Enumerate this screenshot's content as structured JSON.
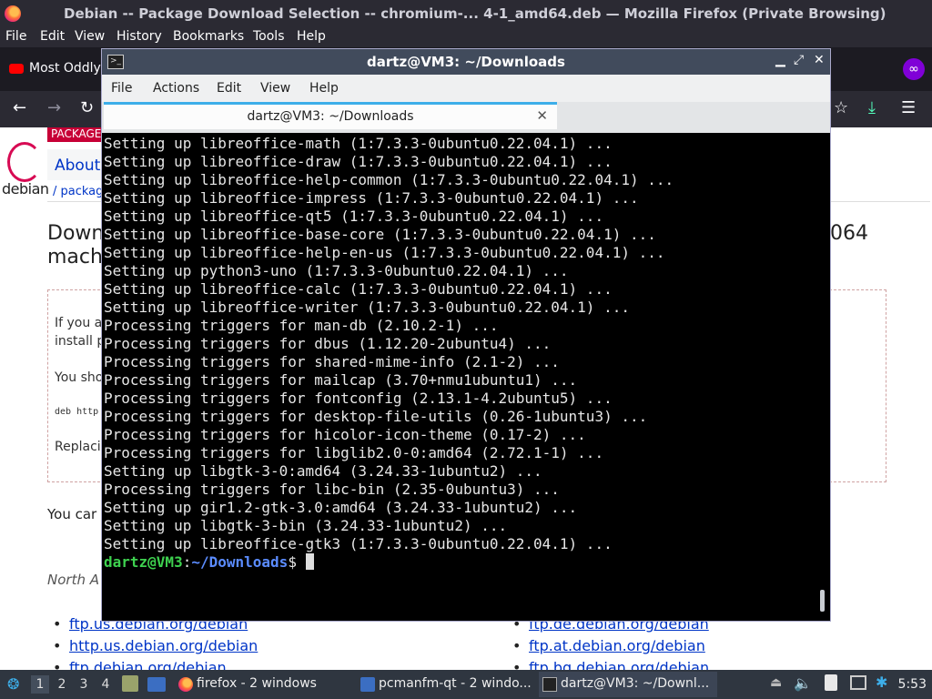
{
  "firefox": {
    "window_title": "Debian -- Package Download Selection -- chromium-... 4-1_amd64.deb — Mozilla Firefox (Private Browsing)",
    "menu": [
      "File",
      "Edit",
      "View",
      "History",
      "Bookmarks",
      "Tools",
      "Help"
    ],
    "tab_label": "Most Oddly",
    "icons": [
      "back-icon",
      "forward-icon",
      "reload-icon",
      "bookmark-star-icon",
      "download-icon",
      "hamburger-menu-icon",
      "private-browsing-icon"
    ]
  },
  "webpage": {
    "logo_text": "debian",
    "band_label": "PACKAGE",
    "about_tab": "About",
    "breadcrumb": "/ packag",
    "heading_line1": "Down",
    "heading_line2": "mach",
    "heading_right": "064",
    "note_line1": "If you a",
    "note_line2": "install p",
    "note_line3": "You sho",
    "note_code": "deb http",
    "note_line4": "Replacin",
    "you_can": "You car",
    "region": "North A",
    "mirrors_left": [
      "ftp.us.debian.org/debian",
      "http.us.debian.org/debian",
      "ftp.debian.org/debian"
    ],
    "mirrors_right": [
      "ftp.de.debian.org/debian",
      "ftp.at.debian.org/debian",
      "ftp.bg.debian.org/debian"
    ]
  },
  "terminal": {
    "window_title": "dartz@VM3: ~/Downloads",
    "menu": [
      "File",
      "Actions",
      "Edit",
      "View",
      "Help"
    ],
    "tab_label": "dartz@VM3: ~/Downloads",
    "lines": [
      "Setting up libreoffice-math (1:7.3.3-0ubuntu0.22.04.1) ...",
      "Setting up libreoffice-draw (1:7.3.3-0ubuntu0.22.04.1) ...",
      "Setting up libreoffice-help-common (1:7.3.3-0ubuntu0.22.04.1) ...",
      "Setting up libreoffice-impress (1:7.3.3-0ubuntu0.22.04.1) ...",
      "Setting up libreoffice-qt5 (1:7.3.3-0ubuntu0.22.04.1) ...",
      "Setting up libreoffice-base-core (1:7.3.3-0ubuntu0.22.04.1) ...",
      "Setting up libreoffice-help-en-us (1:7.3.3-0ubuntu0.22.04.1) ...",
      "Setting up python3-uno (1:7.3.3-0ubuntu0.22.04.1) ...",
      "Setting up libreoffice-calc (1:7.3.3-0ubuntu0.22.04.1) ...",
      "Setting up libreoffice-writer (1:7.3.3-0ubuntu0.22.04.1) ...",
      "Processing triggers for man-db (2.10.2-1) ...",
      "Processing triggers for dbus (1.12.20-2ubuntu4) ...",
      "Processing triggers for shared-mime-info (2.1-2) ...",
      "Processing triggers for mailcap (3.70+nmu1ubuntu1) ...",
      "Processing triggers for fontconfig (2.13.1-4.2ubuntu5) ...",
      "Processing triggers for desktop-file-utils (0.26-1ubuntu3) ...",
      "Processing triggers for hicolor-icon-theme (0.17-2) ...",
      "Processing triggers for libglib2.0-0:amd64 (2.72.1-1) ...",
      "Setting up libgtk-3-0:amd64 (3.24.33-1ubuntu2) ...",
      "Processing triggers for libc-bin (2.35-0ubuntu3) ...",
      "Setting up gir1.2-gtk-3.0:amd64 (3.24.33-1ubuntu2) ...",
      "Setting up libgtk-3-bin (3.24.33-1ubuntu2) ...",
      "Setting up libreoffice-gtk3 (1:7.3.3-0ubuntu0.22.04.1) ..."
    ],
    "prompt_user": "dartz@VM3",
    "prompt_sep": ":",
    "prompt_path": "~/Downloads",
    "prompt_char": "$ "
  },
  "taskbar": {
    "desktops": [
      "1",
      "2",
      "3",
      "4"
    ],
    "active_desktop": "1",
    "tasks": [
      "firefox - 2 windows",
      "pcmanfm-qt - 2 windo...",
      "dartz@VM3: ~/Downl..."
    ],
    "clock": "5:53",
    "colors": {
      "panel": "#2f3640",
      "accent": "#3daee9"
    }
  }
}
